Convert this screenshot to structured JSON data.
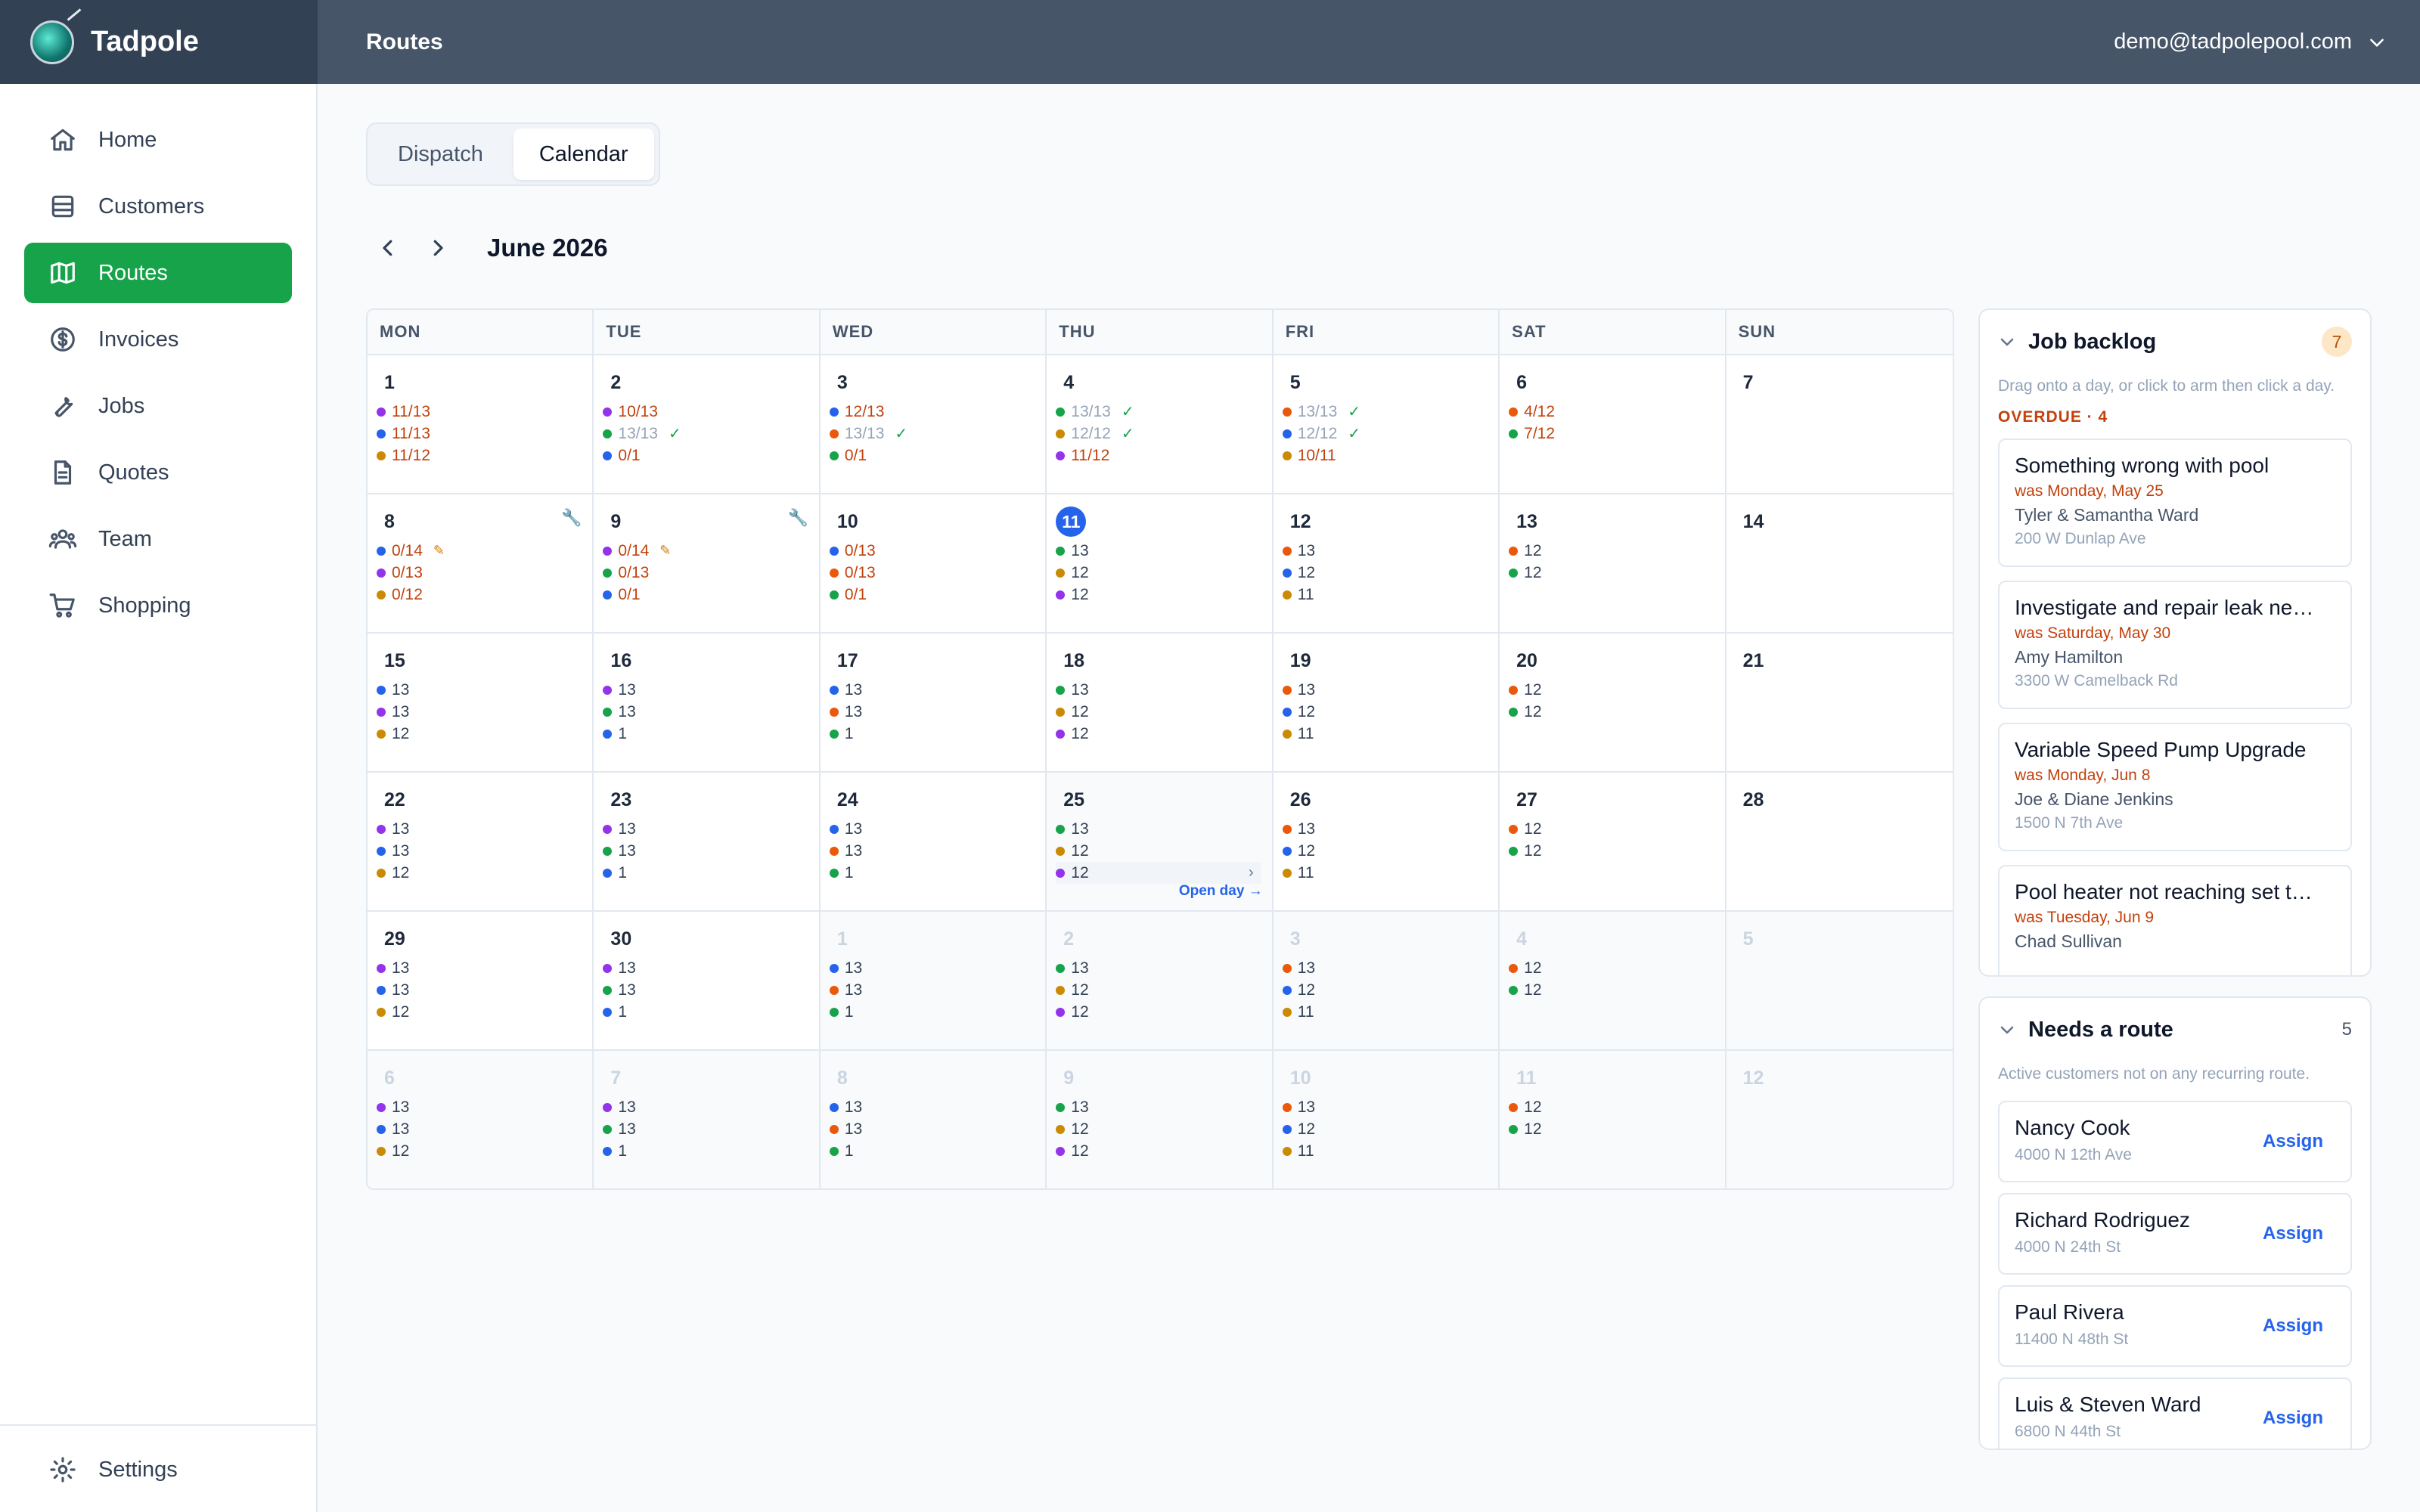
{
  "brand": {
    "name": "Tadpole"
  },
  "header": {
    "title": "Routes",
    "user_email": "demo@tadpolepool.com"
  },
  "sidebar": {
    "items": [
      {
        "label": "Home",
        "icon": "home-icon"
      },
      {
        "label": "Customers",
        "icon": "customers-icon"
      },
      {
        "label": "Routes",
        "icon": "map-icon",
        "active": true
      },
      {
        "label": "Invoices",
        "icon": "dollar-icon"
      },
      {
        "label": "Jobs",
        "icon": "wrench-icon"
      },
      {
        "label": "Quotes",
        "icon": "document-icon"
      },
      {
        "label": "Team",
        "icon": "team-icon"
      },
      {
        "label": "Shopping",
        "icon": "cart-icon"
      }
    ],
    "settings_label": "Settings"
  },
  "tabs": [
    {
      "label": "Dispatch",
      "active": false
    },
    {
      "label": "Calendar",
      "active": true
    }
  ],
  "calendar": {
    "month_label": "June 2026",
    "weekdays": [
      "MON",
      "TUE",
      "WED",
      "THU",
      "FRI",
      "SAT",
      "SUN"
    ],
    "open_day_label": "Open day →",
    "colors": {
      "purple": "#9333ea",
      "blue": "#2563eb",
      "amber": "#ca8a04",
      "orange": "#ea580c",
      "green": "#16a34a"
    },
    "days": [
      {
        "day": "1",
        "routes": [
          {
            "c": "purple",
            "t": "11/13",
            "s": "warn"
          },
          {
            "c": "blue",
            "t": "11/13",
            "s": "warn"
          },
          {
            "c": "amber",
            "t": "11/12",
            "s": "warn"
          }
        ]
      },
      {
        "day": "2",
        "routes": [
          {
            "c": "purple",
            "t": "10/13",
            "s": "warn"
          },
          {
            "c": "green",
            "t": "13/13",
            "s": "done"
          },
          {
            "c": "blue",
            "t": "0/1",
            "s": "warn"
          }
        ]
      },
      {
        "day": "3",
        "routes": [
          {
            "c": "blue",
            "t": "12/13",
            "s": "warn"
          },
          {
            "c": "orange",
            "t": "13/13",
            "s": "done"
          },
          {
            "c": "green",
            "t": "0/1",
            "s": "warn"
          }
        ]
      },
      {
        "day": "4",
        "routes": [
          {
            "c": "green",
            "t": "13/13",
            "s": "done"
          },
          {
            "c": "amber",
            "t": "12/12",
            "s": "done"
          },
          {
            "c": "purple",
            "t": "11/12",
            "s": "warn"
          }
        ]
      },
      {
        "day": "5",
        "routes": [
          {
            "c": "orange",
            "t": "13/13",
            "s": "done"
          },
          {
            "c": "blue",
            "t": "12/12",
            "s": "done"
          },
          {
            "c": "amber",
            "t": "10/11",
            "s": "warn"
          }
        ]
      },
      {
        "day": "6",
        "routes": [
          {
            "c": "orange",
            "t": "4/12",
            "s": "warn"
          },
          {
            "c": "green",
            "t": "7/12",
            "s": "warn"
          }
        ]
      },
      {
        "day": "7",
        "routes": []
      },
      {
        "day": "8",
        "wrench": true,
        "routes": [
          {
            "c": "blue",
            "t": "0/14",
            "s": "warn",
            "pencil": true
          },
          {
            "c": "purple",
            "t": "0/13",
            "s": "warn"
          },
          {
            "c": "amber",
            "t": "0/12",
            "s": "warn"
          }
        ]
      },
      {
        "day": "9",
        "wrench": true,
        "routes": [
          {
            "c": "purple",
            "t": "0/14",
            "s": "warn",
            "pencil": true
          },
          {
            "c": "green",
            "t": "0/13",
            "s": "warn"
          },
          {
            "c": "blue",
            "t": "0/1",
            "s": "warn"
          }
        ]
      },
      {
        "day": "10",
        "routes": [
          {
            "c": "blue",
            "t": "0/13",
            "s": "warn"
          },
          {
            "c": "orange",
            "t": "0/13",
            "s": "warn"
          },
          {
            "c": "green",
            "t": "0/1",
            "s": "warn"
          }
        ]
      },
      {
        "day": "11",
        "today": true,
        "routes": [
          {
            "c": "green",
            "t": "13"
          },
          {
            "c": "amber",
            "t": "12"
          },
          {
            "c": "purple",
            "t": "12"
          }
        ]
      },
      {
        "day": "12",
        "routes": [
          {
            "c": "orange",
            "t": "13"
          },
          {
            "c": "blue",
            "t": "12"
          },
          {
            "c": "amber",
            "t": "11"
          }
        ]
      },
      {
        "day": "13",
        "routes": [
          {
            "c": "orange",
            "t": "12"
          },
          {
            "c": "green",
            "t": "12"
          }
        ]
      },
      {
        "day": "14",
        "routes": []
      },
      {
        "day": "15",
        "routes": [
          {
            "c": "blue",
            "t": "13"
          },
          {
            "c": "purple",
            "t": "13"
          },
          {
            "c": "amber",
            "t": "12"
          }
        ]
      },
      {
        "day": "16",
        "routes": [
          {
            "c": "purple",
            "t": "13"
          },
          {
            "c": "green",
            "t": "13"
          },
          {
            "c": "blue",
            "t": "1"
          }
        ]
      },
      {
        "day": "17",
        "routes": [
          {
            "c": "blue",
            "t": "13"
          },
          {
            "c": "orange",
            "t": "13"
          },
          {
            "c": "green",
            "t": "1"
          }
        ]
      },
      {
        "day": "18",
        "routes": [
          {
            "c": "green",
            "t": "13"
          },
          {
            "c": "amber",
            "t": "12"
          },
          {
            "c": "purple",
            "t": "12"
          }
        ]
      },
      {
        "day": "19",
        "routes": [
          {
            "c": "orange",
            "t": "13"
          },
          {
            "c": "blue",
            "t": "12"
          },
          {
            "c": "amber",
            "t": "11"
          }
        ]
      },
      {
        "day": "20",
        "routes": [
          {
            "c": "orange",
            "t": "12"
          },
          {
            "c": "green",
            "t": "12"
          }
        ]
      },
      {
        "day": "21",
        "routes": []
      },
      {
        "day": "22",
        "routes": [
          {
            "c": "purple",
            "t": "13"
          },
          {
            "c": "blue",
            "t": "13"
          },
          {
            "c": "amber",
            "t": "12"
          }
        ]
      },
      {
        "day": "23",
        "routes": [
          {
            "c": "purple",
            "t": "13"
          },
          {
            "c": "green",
            "t": "13"
          },
          {
            "c": "blue",
            "t": "1"
          }
        ]
      },
      {
        "day": "24",
        "routes": [
          {
            "c": "blue",
            "t": "13"
          },
          {
            "c": "orange",
            "t": "13"
          },
          {
            "c": "green",
            "t": "1"
          }
        ]
      },
      {
        "day": "25",
        "hover": true,
        "routes": [
          {
            "c": "green",
            "t": "13"
          },
          {
            "c": "amber",
            "t": "12"
          },
          {
            "c": "purple",
            "t": "12",
            "hl": true
          }
        ]
      },
      {
        "day": "26",
        "routes": [
          {
            "c": "orange",
            "t": "13"
          },
          {
            "c": "blue",
            "t": "12"
          },
          {
            "c": "amber",
            "t": "11"
          }
        ]
      },
      {
        "day": "27",
        "routes": [
          {
            "c": "orange",
            "t": "12"
          },
          {
            "c": "green",
            "t": "12"
          }
        ]
      },
      {
        "day": "28",
        "routes": []
      },
      {
        "day": "29",
        "routes": [
          {
            "c": "purple",
            "t": "13"
          },
          {
            "c": "blue",
            "t": "13"
          },
          {
            "c": "amber",
            "t": "12"
          }
        ]
      },
      {
        "day": "30",
        "routes": [
          {
            "c": "purple",
            "t": "13"
          },
          {
            "c": "green",
            "t": "13"
          },
          {
            "c": "blue",
            "t": "1"
          }
        ]
      },
      {
        "day": "1",
        "outside": true,
        "routes": [
          {
            "c": "blue",
            "t": "13"
          },
          {
            "c": "orange",
            "t": "13"
          },
          {
            "c": "green",
            "t": "1"
          }
        ]
      },
      {
        "day": "2",
        "outside": true,
        "routes": [
          {
            "c": "green",
            "t": "13"
          },
          {
            "c": "amber",
            "t": "12"
          },
          {
            "c": "purple",
            "t": "12"
          }
        ]
      },
      {
        "day": "3",
        "outside": true,
        "routes": [
          {
            "c": "orange",
            "t": "13"
          },
          {
            "c": "blue",
            "t": "12"
          },
          {
            "c": "amber",
            "t": "11"
          }
        ]
      },
      {
        "day": "4",
        "outside": true,
        "routes": [
          {
            "c": "orange",
            "t": "12"
          },
          {
            "c": "green",
            "t": "12"
          }
        ]
      },
      {
        "day": "5",
        "outside": true,
        "routes": []
      },
      {
        "day": "6",
        "outside": true,
        "routes": [
          {
            "c": "purple",
            "t": "13"
          },
          {
            "c": "blue",
            "t": "13"
          },
          {
            "c": "amber",
            "t": "12"
          }
        ]
      },
      {
        "day": "7",
        "outside": true,
        "routes": [
          {
            "c": "purple",
            "t": "13"
          },
          {
            "c": "green",
            "t": "13"
          },
          {
            "c": "blue",
            "t": "1"
          }
        ]
      },
      {
        "day": "8",
        "outside": true,
        "routes": [
          {
            "c": "blue",
            "t": "13"
          },
          {
            "c": "orange",
            "t": "13"
          },
          {
            "c": "green",
            "t": "1"
          }
        ]
      },
      {
        "day": "9",
        "outside": true,
        "routes": [
          {
            "c": "green",
            "t": "13"
          },
          {
            "c": "amber",
            "t": "12"
          },
          {
            "c": "purple",
            "t": "12"
          }
        ]
      },
      {
        "day": "10",
        "outside": true,
        "routes": [
          {
            "c": "orange",
            "t": "13"
          },
          {
            "c": "blue",
            "t": "12"
          },
          {
            "c": "amber",
            "t": "11"
          }
        ]
      },
      {
        "day": "11",
        "outside": true,
        "routes": [
          {
            "c": "orange",
            "t": "12"
          },
          {
            "c": "green",
            "t": "12"
          }
        ]
      },
      {
        "day": "12",
        "outside": true,
        "routes": []
      }
    ]
  },
  "backlog": {
    "title": "Job backlog",
    "count": "7",
    "hint": "Drag onto a day, or click to arm then click a day.",
    "overdue_label": "OVERDUE · 4",
    "jobs": [
      {
        "title": "Something wrong with pool",
        "was": "was Monday, May 25",
        "customer": "Tyler & Samantha Ward",
        "address": "200 W Dunlap Ave"
      },
      {
        "title": "Investigate and repair leak ne…",
        "was": "was Saturday, May 30",
        "customer": "Amy Hamilton",
        "address": "3300 W Camelback Rd"
      },
      {
        "title": "Variable Speed Pump Upgrade",
        "was": "was Monday, Jun 8",
        "customer": "Joe & Diane Jenkins",
        "address": "1500 N 7th Ave"
      },
      {
        "title": "Pool heater not reaching set t…",
        "was": "was Tuesday, Jun 9",
        "customer": "Chad Sullivan",
        "address": ""
      }
    ]
  },
  "needs_route": {
    "title": "Needs a route",
    "count": "5",
    "hint": "Active customers not on any recurring route.",
    "assign_label": "Assign",
    "customers": [
      {
        "name": "Nancy Cook",
        "address": "4000 N 12th Ave"
      },
      {
        "name": "Richard Rodriguez",
        "address": "4000 N 24th St"
      },
      {
        "name": "Paul Rivera",
        "address": "11400 N 48th St"
      },
      {
        "name": "Luis & Steven Ward",
        "address": "6800 N 44th St"
      }
    ]
  }
}
